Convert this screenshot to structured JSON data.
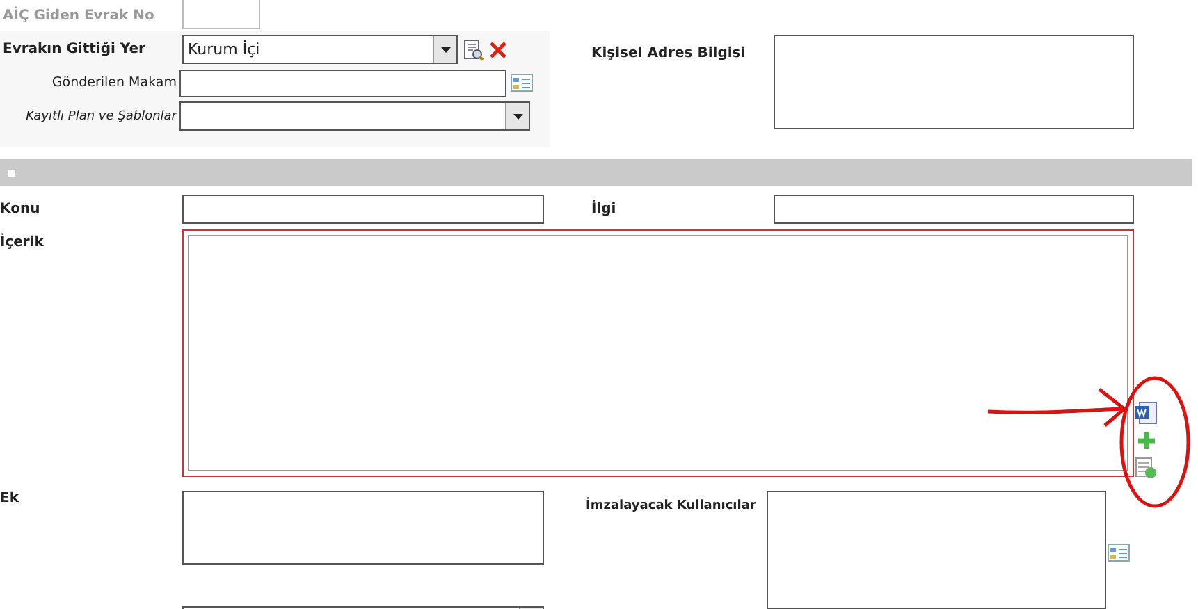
{
  "giden_evrak_no": {
    "label": "AİÇ Giden Evrak No",
    "disabled": true
  },
  "gittigi_yer": {
    "label": "Evrakın Gittiği Yer",
    "value": "Kurum İçi"
  },
  "gonderilen_makam": {
    "label": "Gönderilen Makam"
  },
  "kayitli_plan": {
    "label": "Kayıtlı Plan ve Şablonlar"
  },
  "kisisel_adres": {
    "label": "Kişisel Adres Bilgisi"
  },
  "konu": {
    "label": "Konu"
  },
  "ilgi": {
    "label": "İlgi"
  },
  "icerik": {
    "label": "İçerik"
  },
  "ek": {
    "label": "Ek"
  },
  "imzalayacak": {
    "label": "İmzalayacak Kullanıcılar"
  }
}
